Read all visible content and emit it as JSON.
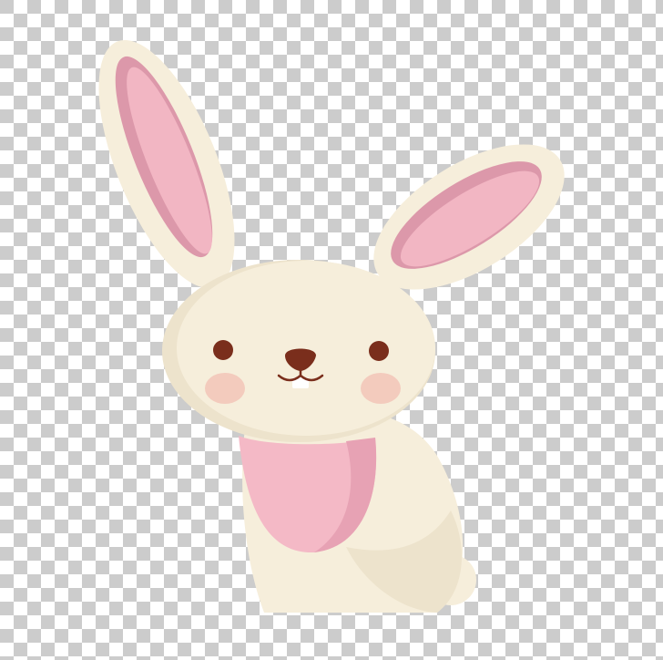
{
  "image": {
    "subject": "bunny-illustration",
    "background": "transparency-checkerboard",
    "colors": {
      "fur": "#f6eedb",
      "fur_shadow": "#ede3cc",
      "ear_inner": "#f2b6c3",
      "ear_inner_shadow": "#dc98aa",
      "bib": "#f4b9c6",
      "bib_shadow": "#e7a2b4",
      "eyes": "#7a2e1c",
      "cheeks": "#f3cbbd",
      "checker_gray": "#cccccc"
    }
  }
}
